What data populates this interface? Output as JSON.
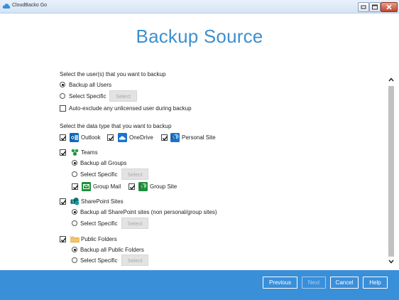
{
  "window": {
    "title": "CloudBacko Go",
    "controls": [
      "restore-icon",
      "maximize-icon",
      "close-icon"
    ]
  },
  "page_title": "Backup Source",
  "users": {
    "heading": "Select the user(s) that you want to backup",
    "backup_all": "Backup all Users",
    "select_specific": "Select Specific",
    "select_button": "Select",
    "auto_exclude": "Auto-exclude any unlicensed user during backup",
    "selected": "Backup all Users"
  },
  "data_type": {
    "heading": "Select the data type that you want to backup",
    "outlook": "Outlook",
    "onedrive": "OneDrive",
    "personal_site": "Personal Site"
  },
  "teams": {
    "label": "Teams",
    "backup_all": "Backup all Groups",
    "select_specific": "Select Specific",
    "select_button": "Select",
    "group_mail": "Group Mail",
    "group_site": "Group Site"
  },
  "sharepoint": {
    "label": "SharePoint Sites",
    "backup_all": "Backup all SharePoint sites (non personal/group sites)",
    "select_specific": "Select Specific",
    "select_button": "Select"
  },
  "public_folders": {
    "label": "Public Folders",
    "backup_all": "Backup all Public Folders",
    "select_specific": "Select Specific",
    "select_button": "Select"
  },
  "footer": {
    "previous": "Previous",
    "next": "Next",
    "cancel": "Cancel",
    "help": "Help"
  },
  "colors": {
    "accent": "#3d8fce",
    "footer_bg": "#3a8fd9",
    "outlook": "#0f6cbd",
    "onedrive": "#1a73d1",
    "sharepoint": "#04777a",
    "teams": "#27a144",
    "folder": "#f3c466"
  }
}
